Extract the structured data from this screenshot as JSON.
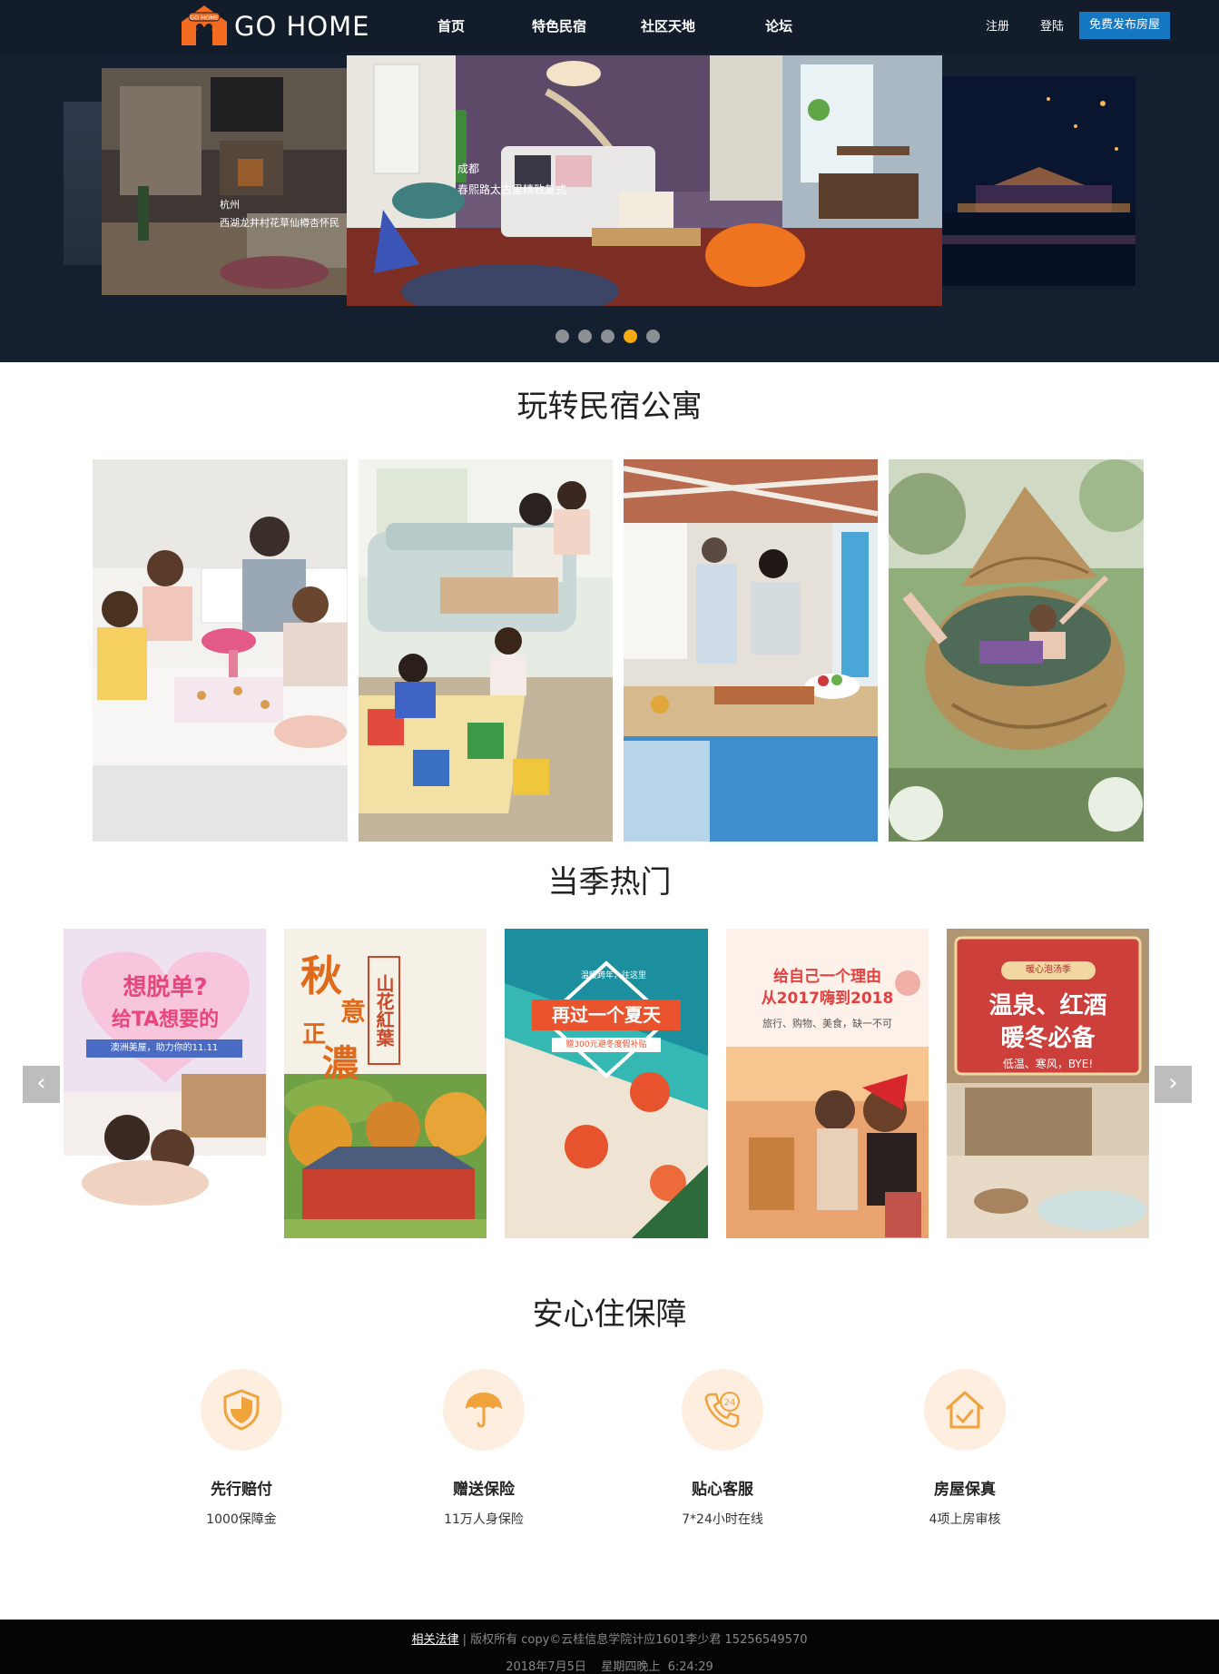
{
  "header": {
    "logo_badge": "GO HOME",
    "logo_text": "GO HOME",
    "nav": [
      "首页",
      "特色民宿",
      "社区天地",
      "论坛"
    ],
    "register": "注册",
    "login": "登陆",
    "publish": "免费发布房屋"
  },
  "hero": {
    "left_caption_city": "杭州",
    "left_caption_text": "西湖龙井村花草仙樽杏怀民",
    "main_caption_city": "成都",
    "main_caption_text": "春熙路太古里精致复式",
    "dots_count": 5,
    "active_dot": 4
  },
  "section1": {
    "title": "玩转民宿公寓"
  },
  "section2": {
    "title": "当季热门",
    "prev_arrow": "‹",
    "next_arrow": "›",
    "promos": [
      {
        "line1": "想脱单?",
        "line2": "给TA想要的",
        "line3": "澳洲美屋，助力你的11.11"
      },
      {
        "big1": "秋",
        "big2": "意",
        "big3": "正",
        "big4": "濃",
        "side": "山花紅葉"
      },
      {
        "tag": "温暖跨年，往这里",
        "main": "再过一个夏天",
        "sub": "赠300元避冬度假补贴"
      },
      {
        "line1": "给自己一个理由",
        "line2": "从2017嗨到2018",
        "line3": "旅行、购物、美食，缺一不可"
      },
      {
        "tag": "暖心泡汤季",
        "line1": "温泉、红酒",
        "line2": "暖冬必备",
        "line3": "低温、寒风，BYE!"
      }
    ]
  },
  "section3": {
    "title": "安心住保障",
    "features": [
      {
        "title": "先行赔付",
        "sub": "1000保障金",
        "icon": "shield-icon"
      },
      {
        "title": "赠送保险",
        "sub": "11万人身保险",
        "icon": "umbrella-icon"
      },
      {
        "title": "贴心客服",
        "sub": "7*24小时在线",
        "icon": "phone-24-icon"
      },
      {
        "title": "房屋保真",
        "sub": "4项上房审核",
        "icon": "house-check-icon"
      }
    ]
  },
  "footer": {
    "legal_link": "相关法律",
    "copyright": " | 版权所有 copy©云桂信息学院计应1601李少君 15256549570",
    "datetime": "2018年7月5日    星期四晚上  6:24:29"
  },
  "colors": {
    "topbar": "#121c2b",
    "hero_bg": "#14202f",
    "publish_button": "#1477c2",
    "active_dot": "#f5ab12",
    "feature_circle": "#fdeee0",
    "feature_icon": "#f0a23b"
  }
}
